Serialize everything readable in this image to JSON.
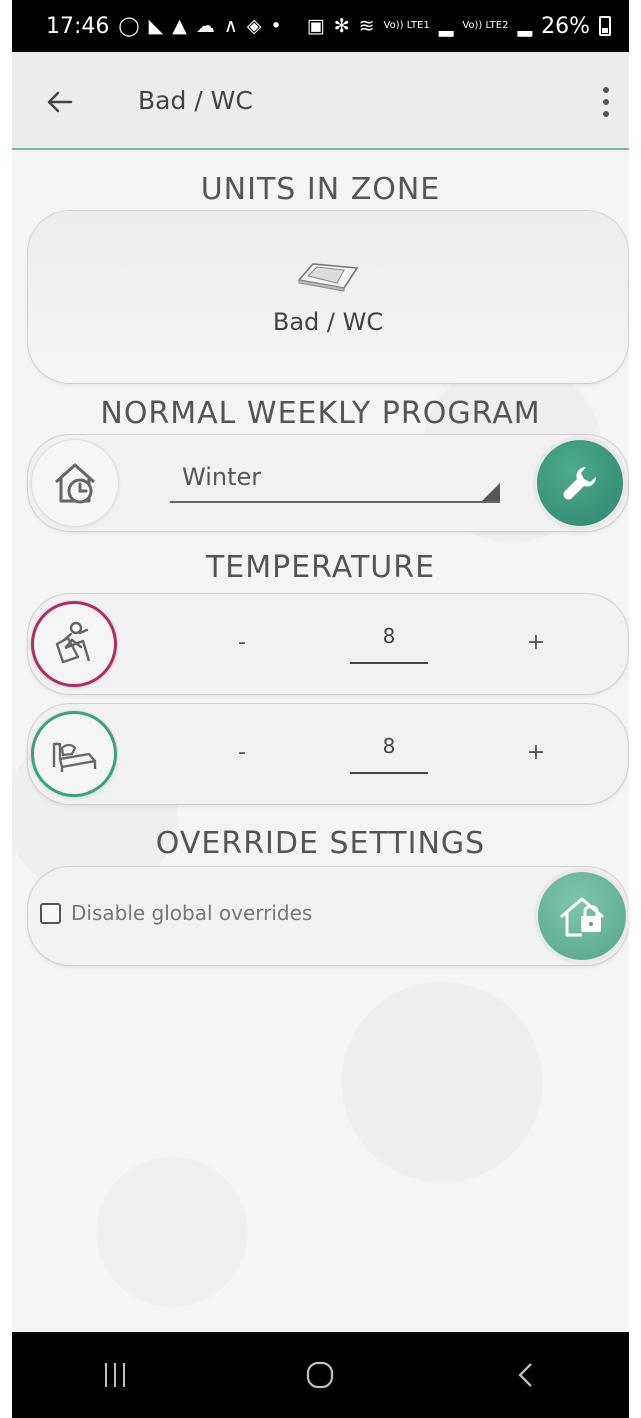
{
  "status_bar": {
    "time": "17:46",
    "battery_percent": "26%",
    "volte1": "Vo)) LTE1",
    "volte2": "Vo)) LTE2",
    "left_icons": [
      "whatsapp-icon",
      "sail-icon",
      "bell-icon",
      "cloud-icon",
      "signal-wave-icon",
      "layers-icon"
    ],
    "right_icons": [
      "battery-saver-icon",
      "bluetooth-icon",
      "wifi-icon",
      "signal-bars-icon"
    ]
  },
  "toolbar": {
    "title": "Bad / WC",
    "back_icon": "arrow-left-icon",
    "menu_icon": "more-vertical-icon"
  },
  "units": {
    "section_title": "UNITS IN ZONE",
    "unit_icon": "panel-heater-icon",
    "unit_label": "Bad / WC"
  },
  "program": {
    "section_title": "NORMAL WEEKLY PROGRAM",
    "icon": "house-clock-icon",
    "selected": "Winter",
    "settings_icon": "wrench-icon"
  },
  "temperature": {
    "section_title": "TEMPERATURE",
    "comfort": {
      "icon": "relax-chair-icon",
      "minus_label": "-",
      "plus_label": "+",
      "value": "8"
    },
    "night": {
      "icon": "bed-icon",
      "minus_label": "-",
      "plus_label": "+",
      "value": "8"
    }
  },
  "override": {
    "section_title": "OVERRIDE SETTINGS",
    "checkbox_label": "Disable global overrides",
    "checked": false,
    "lock_icon": "house-lock-icon"
  },
  "navigation": {
    "recent_icon": "recent-apps-icon",
    "home_icon": "home-icon",
    "back_icon": "back-chevron-icon"
  },
  "colors": {
    "accent_green": "#2f876f",
    "comfort_ring": "#b02c63",
    "night_ring": "#3ba27d",
    "status_bar_bg": "#000000",
    "toolbar_bg": "#ececec"
  }
}
